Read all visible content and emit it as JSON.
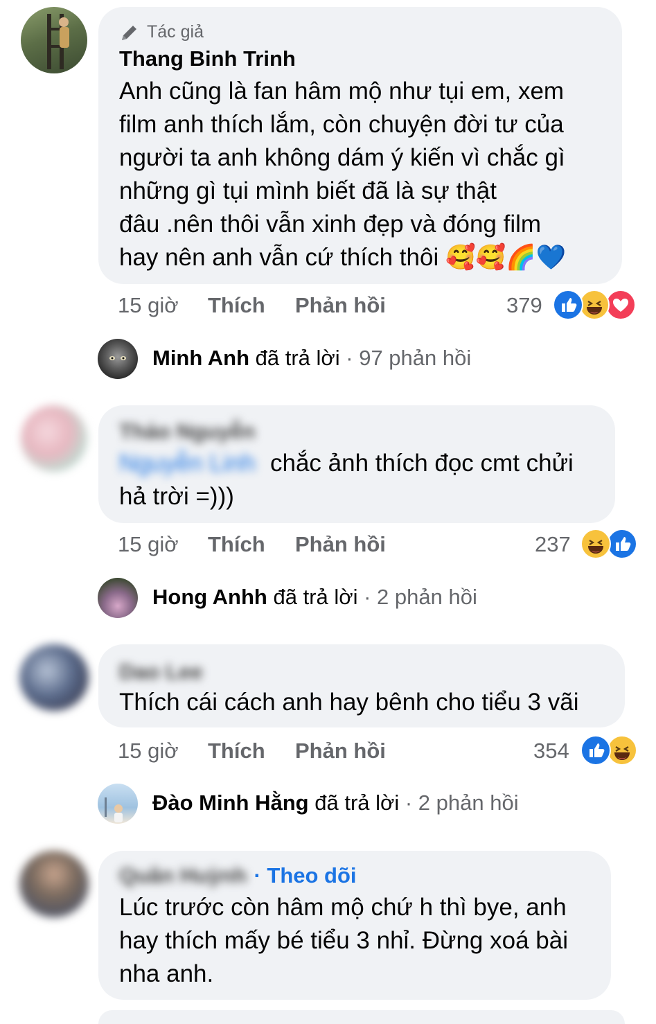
{
  "comments": [
    {
      "author_badge": "Tác giả",
      "author": "Thang Binh Trinh",
      "lines": [
        "Anh cũng là fan hâm mộ như tụi em, xem",
        "film anh thích lắm, còn chuyện đời tư của",
        "người ta anh không dám ý kiến vì chắc gì",
        "những gì tụi mình biết đã là sự thật",
        "đâu .nên thôi vẫn xinh đẹp và đóng film",
        "hay nên anh vẫn cứ thích thôi 🥰🥰🌈💙"
      ],
      "time": "15 giờ",
      "like_label": "Thích",
      "reply_label": "Phản hồi",
      "reaction_count": "379",
      "reactions": [
        "like",
        "haha",
        "love"
      ],
      "reply_summary": {
        "name": "Minh Anh",
        "verb": "đã trả lời",
        "count": "· 97 phản hồi"
      }
    },
    {
      "author": "Thảo Nguyễn",
      "mention": "Nguyễn Linh",
      "lines": [
        "chắc ảnh thích đọc cmt chửi",
        "hả trời =)))"
      ],
      "time": "15 giờ",
      "like_label": "Thích",
      "reply_label": "Phản hồi",
      "reaction_count": "237",
      "reactions": [
        "haha",
        "like"
      ],
      "reply_summary": {
        "name": "Hong Anhh",
        "verb": "đã trả lời",
        "count": "· 2 phản hồi"
      }
    },
    {
      "author": "Dao Lee",
      "lines": [
        "Thích cái cách anh hay bênh cho tiểu 3 vãi"
      ],
      "time": "15 giờ",
      "like_label": "Thích",
      "reply_label": "Phản hồi",
      "reaction_count": "354",
      "reactions": [
        "like",
        "haha"
      ],
      "reply_summary": {
        "name": "Đào Minh Hằng",
        "verb": "đã trả lời",
        "count": "· 2 phản hồi"
      }
    },
    {
      "author": "Quân Huỳnh",
      "follow": "· Theo dõi",
      "lines": [
        "Lúc trước còn hâm mộ chứ h thì bye, anh",
        "hay thích mấy bé tiểu 3 nhỉ. Đừng xoá bài",
        "nha anh."
      ]
    }
  ],
  "colors": {
    "bubble": "#f0f2f5",
    "meta": "#65676b",
    "link": "#1b74e4",
    "like": "#1b74e4",
    "haha": "#f7c23c",
    "love": "#f33e58"
  },
  "icons": [
    "pencil-icon",
    "like-reaction-icon",
    "haha-reaction-icon",
    "love-reaction-icon"
  ]
}
